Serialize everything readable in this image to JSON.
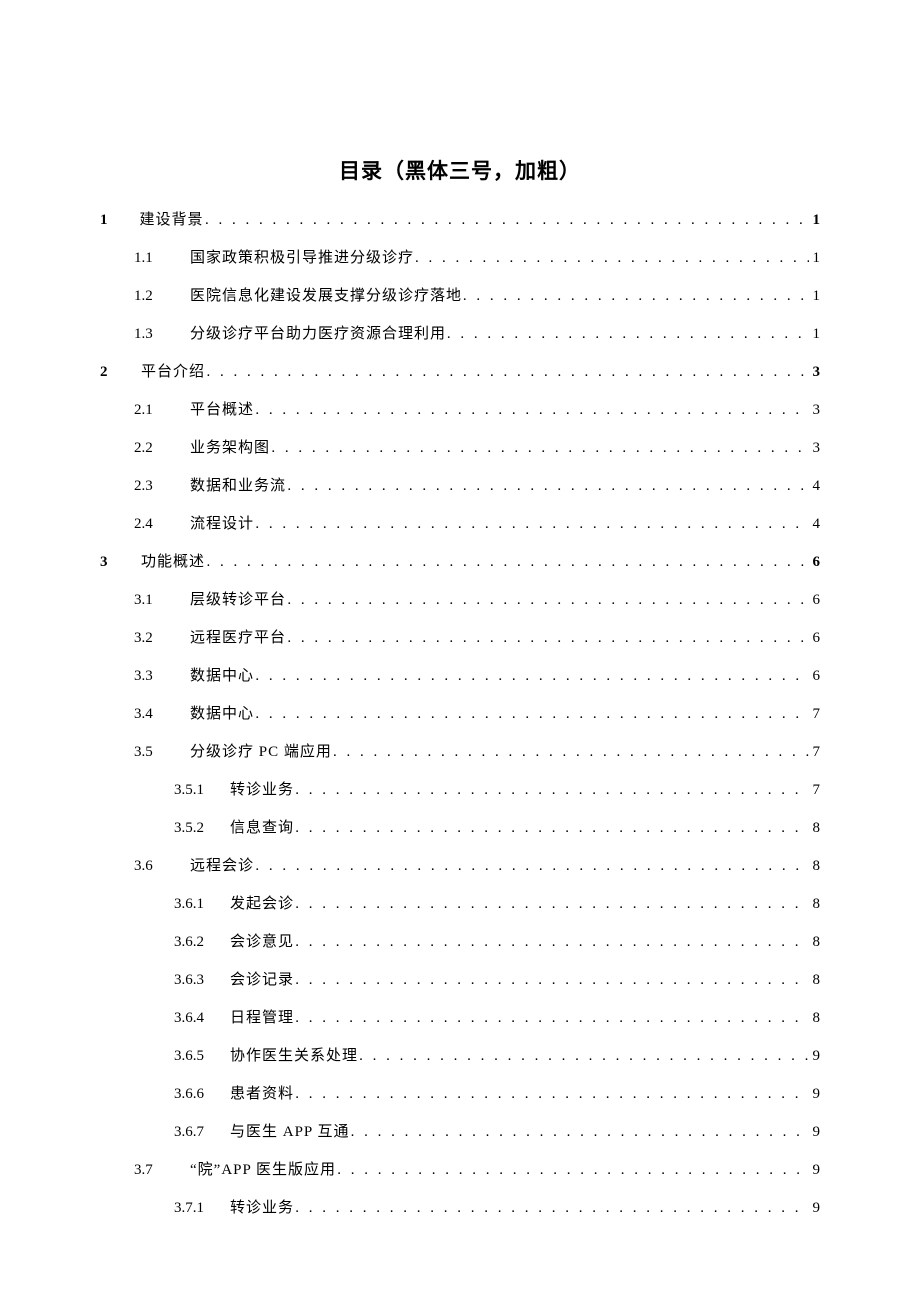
{
  "title": "目录（黑体三号，加粗）",
  "entries": [
    {
      "level": 1,
      "num": "1",
      "text": "建设背景",
      "page": "1",
      "numBold": true
    },
    {
      "level": 2,
      "num": "1.1",
      "text": "国家政策积极引导推进分级诊疗",
      "page": "1"
    },
    {
      "level": 2,
      "num": "1.2",
      "text": "医院信息化建设发展支撑分级诊疗落地",
      "page": "1"
    },
    {
      "level": 2,
      "num": "1.3",
      "text": "分级诊疗平台助力医疗资源合理利用",
      "page": "1"
    },
    {
      "level": 1,
      "num": "2",
      "text": "平台介绍",
      "page": "3",
      "numBold": true,
      "gap": true
    },
    {
      "level": 2,
      "num": "2.1",
      "text": "平台概述",
      "page": "3"
    },
    {
      "level": 2,
      "num": "2.2",
      "text": "业务架构图",
      "page": "3"
    },
    {
      "level": 2,
      "num": "2.3",
      "text": "数据和业务流",
      "page": "4"
    },
    {
      "level": 2,
      "num": "2.4",
      "text": "流程设计",
      "page": "4"
    },
    {
      "level": 1,
      "num": "3",
      "text": "功能概述",
      "page": "6",
      "numBold": true,
      "gap": true
    },
    {
      "level": 2,
      "num": "3.1",
      "text": "层级转诊平台",
      "page": "6"
    },
    {
      "level": 2,
      "num": "3.2",
      "text": "远程医疗平台",
      "page": "6"
    },
    {
      "level": 2,
      "num": "3.3",
      "text": "数据中心",
      "page": "6"
    },
    {
      "level": 2,
      "num": "3.4",
      "text": "数据中心",
      "page": "7"
    },
    {
      "level": 2,
      "num": "3.5",
      "text": "分级诊疗 PC 端应用",
      "page": "7"
    },
    {
      "level": 3,
      "num": "3.5.1",
      "text": "转诊业务",
      "page": "7"
    },
    {
      "level": 3,
      "num": "3.5.2",
      "text": "信息查询",
      "page": "8"
    },
    {
      "level": 2,
      "num": "3.6",
      "text": "远程会诊",
      "page": "8"
    },
    {
      "level": 3,
      "num": "3.6.1",
      "text": "发起会诊",
      "page": "8"
    },
    {
      "level": 3,
      "num": "3.6.2",
      "text": "会诊意见",
      "page": "8"
    },
    {
      "level": 3,
      "num": "3.6.3",
      "text": "会诊记录",
      "page": "8"
    },
    {
      "level": 3,
      "num": "3.6.4",
      "text": "日程管理",
      "page": "8"
    },
    {
      "level": 3,
      "num": "3.6.5",
      "text": "协作医生关系处理",
      "page": "9"
    },
    {
      "level": 3,
      "num": "3.6.6",
      "text": "患者资料",
      "page": "9"
    },
    {
      "level": 3,
      "num": "3.6.7",
      "text": "与医生 APP 互通",
      "page": "9"
    },
    {
      "level": 2,
      "num": "3.7",
      "text": "“院”APP 医生版应用",
      "page": "9"
    },
    {
      "level": 3,
      "num": "3.7.1",
      "text": "转诊业务",
      "page": "9"
    }
  ]
}
